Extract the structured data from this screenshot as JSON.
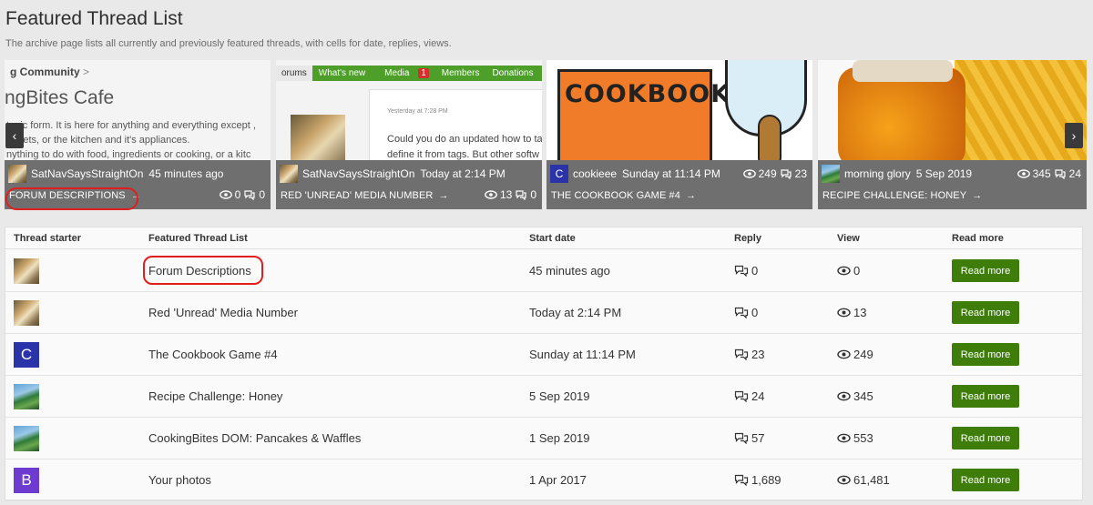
{
  "header": {
    "title": "Featured Thread List",
    "description": "The archive page lists all currently and previously featured threads, with cells for date, replies, views."
  },
  "carousel": {
    "prev_icon": "chevron-left-icon",
    "next_icon": "chevron-right-icon",
    "slides": [
      {
        "img_text1": "g Community",
        "img_text1_chevron": ">",
        "img_text2": "ngBites Cafe",
        "img_text3": "topic form. It is here for anything and everything except ,\nadgets, or the kitchen and it's appliances.\nnything to do with food, ingredients or cooking, or a kitc",
        "user": "SatNavSaysStraightOn",
        "date": "45 minutes ago",
        "views": "0",
        "replies": "0",
        "title": "FORUM DESCRIPTIONS"
      },
      {
        "nav_first": "orums",
        "nav": [
          "What's new",
          "Media",
          "Members",
          "Donations"
        ],
        "media_badge": "1",
        "img_ts": "Yesterday at 7:28 PM",
        "img_text": "Could you do an updated how to ta\ndefine it from tags. But other softw\nfinal, the original, or a kitc",
        "user": "SatNavSaysStraightOn",
        "date": "Today at 2:14 PM",
        "views": "13",
        "replies": "0",
        "title": "RED 'UNREAD' MEDIA NUMBER"
      },
      {
        "img_text": "COOKBOOK",
        "avatar_letter": "C",
        "user": "cookieee",
        "date": "Sunday at 11:14 PM",
        "views": "249",
        "replies": "23",
        "title": "THE COOKBOOK GAME #4"
      },
      {
        "user": "morning glory",
        "date": "5 Sep 2019",
        "views": "345",
        "replies": "24",
        "title": "RECIPE CHALLENGE: HONEY"
      }
    ]
  },
  "table": {
    "headers": [
      "Thread starter",
      "Featured Thread List",
      "Start date",
      "Reply",
      "View",
      "Read more"
    ],
    "rows": [
      {
        "avatar": "photo",
        "title": "Forum Descriptions",
        "date": "45 minutes ago",
        "replies": "0",
        "views": "0",
        "button": "Read more"
      },
      {
        "avatar": "photo",
        "title": "Red 'Unread' Media Number",
        "date": "Today at 2:14 PM",
        "replies": "0",
        "views": "13",
        "button": "Read more"
      },
      {
        "avatar": "letter",
        "letter": "C",
        "title": "The Cookbook Game #4",
        "date": "Sunday at 11:14 PM",
        "replies": "23",
        "views": "249",
        "button": "Read more"
      },
      {
        "avatar": "plant",
        "title": "Recipe Challenge: Honey",
        "date": "5 Sep 2019",
        "replies": "24",
        "views": "345",
        "button": "Read more"
      },
      {
        "avatar": "plant",
        "title": "CookingBites DOM: Pancakes & Waffles",
        "date": "1 Sep 2019",
        "replies": "57",
        "views": "553",
        "button": "Read more"
      },
      {
        "avatar": "letter",
        "letter": "B",
        "title": "Your photos",
        "date": "1 Apr 2017",
        "replies": "1,689",
        "views": "61,481",
        "button": "Read more"
      }
    ]
  },
  "colors": {
    "button_green": "#3f7d0a",
    "nav_green": "#4d9f2a",
    "highlight_red": "#e01e1e",
    "avatar_c": "#2b33a8",
    "avatar_b": "#6e3bd1"
  }
}
